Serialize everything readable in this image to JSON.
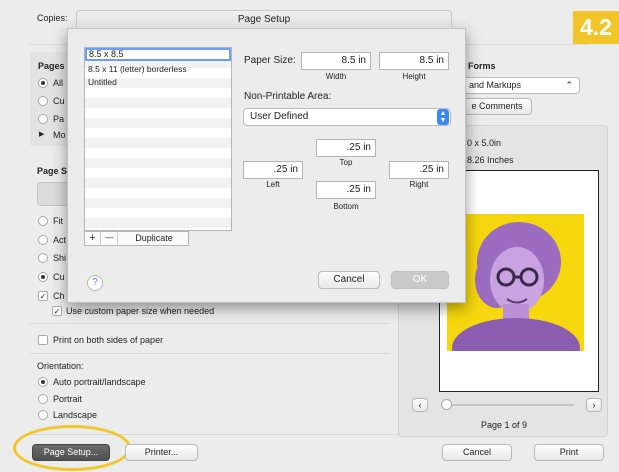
{
  "main": {
    "copies_label": "Copies:",
    "pages_label": "Pages",
    "pages_radios": [
      "All",
      "Cu",
      "Pa"
    ],
    "more_label": "Mo",
    "page_scaling_label": "Page S",
    "scaling_radios": [
      "Fit",
      "Act",
      "Shi",
      "Cu"
    ],
    "choose_label": "Ch",
    "use_custom_label": "Use custom paper size when needed",
    "both_sides_label": "Print on both sides of paper",
    "orientation_label": "Orientation:",
    "orientation_options": [
      "Auto portrait/landscape",
      "Portrait",
      "Landscape"
    ],
    "page_setup_button": "Page Setup...",
    "printer_button": "Printer..."
  },
  "right": {
    "forms_heading": "Forms",
    "forms_select": "and Markups",
    "comments_button": "e Comments",
    "size_text": "0 x 5.0in",
    "size_inches": "8.26 Inches",
    "page_counter": "Page 1 of 9",
    "cancel_button": "Cancel",
    "print_button": "Print"
  },
  "badge": "4.2",
  "dialog": {
    "title": "Page Setup",
    "list_items": [
      "8.5 x 8.5",
      "8.5 x 11 (letter) borderless",
      "Untitled"
    ],
    "add_label": "+",
    "remove_label": "—",
    "duplicate_label": "Duplicate",
    "help_label": "?",
    "paper_size_label": "Paper Size:",
    "width_value": "8.5 in",
    "height_value": "8.5 in",
    "width_label": "Width",
    "height_label": "Height",
    "nonprintable_label": "Non-Printable Area:",
    "area_select": "User Defined",
    "top_value": ".25 in",
    "left_value": ".25 in",
    "right_value": ".25 in",
    "bottom_value": ".25 in",
    "top_label": "Top",
    "left_label": "Left",
    "right_label": "Right",
    "bottom_label": "Bottom",
    "cancel_label": "Cancel",
    "ok_label": "OK"
  },
  "colors": {
    "portrait_background": "#f6d70e",
    "portrait_figure": "#9b6cc0",
    "highlight_ring": "#f2c629",
    "accent": "#3b87f5"
  }
}
